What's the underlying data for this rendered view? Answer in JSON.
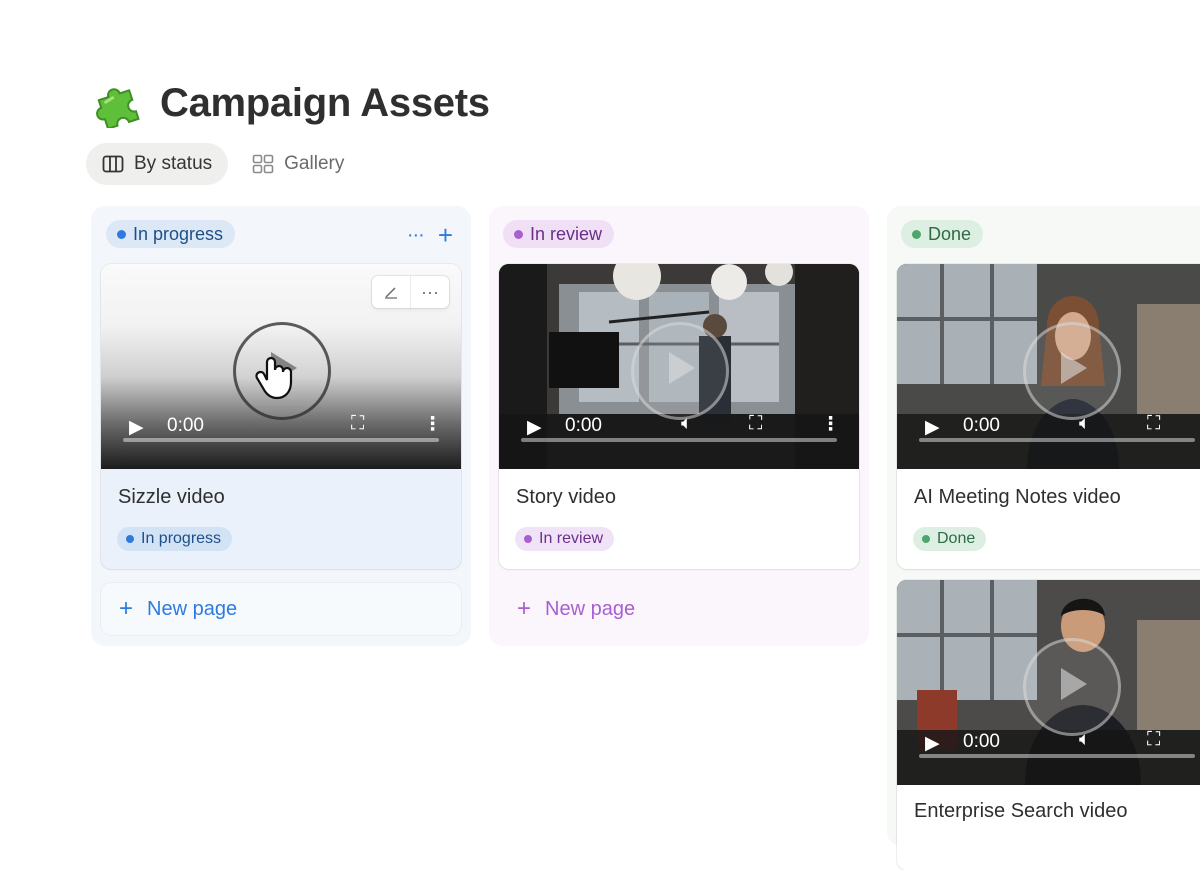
{
  "page": {
    "title": "Campaign Assets",
    "title_icon": "puzzle-piece-icon"
  },
  "views": [
    {
      "label": "By status",
      "icon": "board-columns-icon",
      "active": true
    },
    {
      "label": "Gallery",
      "icon": "gallery-grid-icon",
      "active": false
    }
  ],
  "columns": [
    {
      "status": "In progress",
      "color": "#2d7be0",
      "new_page_label": "New page",
      "cards": [
        {
          "title": "Sizzle video",
          "status": "In progress",
          "time": "0:00"
        }
      ]
    },
    {
      "status": "In review",
      "color": "#a95fd0",
      "new_page_label": "New page",
      "cards": [
        {
          "title": "Story video",
          "status": "In review",
          "time": "0:00"
        }
      ]
    },
    {
      "status": "Done",
      "color": "#4ea66c",
      "cards": [
        {
          "title": "AI Meeting Notes video",
          "status": "Done",
          "time": "0:00"
        },
        {
          "title": "Enterprise Search video",
          "time": "0:00"
        }
      ]
    }
  ],
  "column_actions": {
    "more": "···",
    "add": "+"
  },
  "card_hover_tools": [
    "edit-icon",
    "more-icon"
  ]
}
